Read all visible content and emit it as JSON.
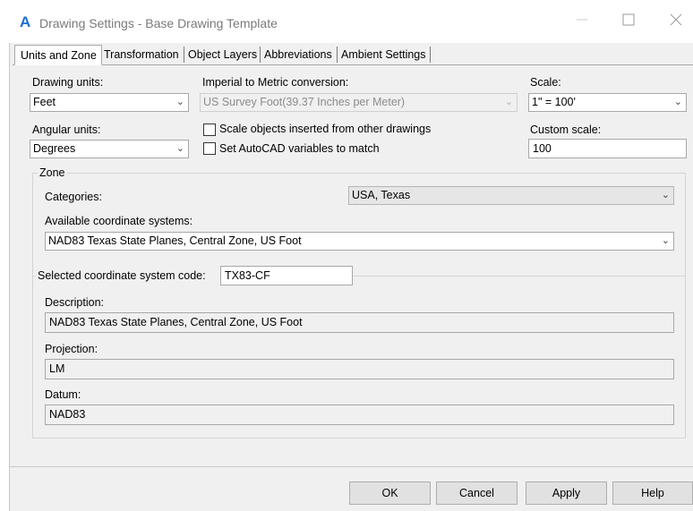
{
  "window": {
    "title": "Drawing Settings - Base Drawing Template"
  },
  "tabs": [
    {
      "label": "Units and Zone",
      "active": true
    },
    {
      "label": "Transformation"
    },
    {
      "label": "Object Layers"
    },
    {
      "label": "Abbreviations"
    },
    {
      "label": "Ambient Settings"
    }
  ],
  "units": {
    "drawing_units_label": "Drawing units:",
    "drawing_units_value": "Feet",
    "conversion_label": "Imperial to Metric conversion:",
    "conversion_value": "US Survey Foot(39.37 Inches per Meter)",
    "scale_label": "Scale:",
    "scale_value": "1\" = 100'",
    "angular_units_label": "Angular units:",
    "angular_units_value": "Degrees",
    "scale_objects_label": "Scale objects inserted from other drawings",
    "set_autocad_label": "Set AutoCAD variables to match",
    "custom_scale_label": "Custom scale:",
    "custom_scale_value": "100"
  },
  "zone": {
    "group_label": "Zone",
    "categories_label": "Categories:",
    "categories_value": "USA, Texas",
    "available_label": "Available coordinate systems:",
    "available_value": "NAD83 Texas State Planes, Central Zone, US Foot",
    "code_label": "Selected coordinate system code:",
    "code_value": "TX83-CF",
    "description_label": "Description:",
    "description_value": "NAD83 Texas State Planes, Central Zone, US Foot",
    "projection_label": "Projection:",
    "projection_value": "LM",
    "datum_label": "Datum:",
    "datum_value": "NAD83"
  },
  "buttons": {
    "ok": "OK",
    "cancel": "Cancel",
    "apply": "Apply",
    "help": "Help"
  },
  "icons": {
    "app": "autocad-icon",
    "minimize": "minimize-icon",
    "maximize": "maximize-icon",
    "close": "close-icon",
    "dropdown": "chevron-down-icon"
  },
  "colors": {
    "accent": "#1f6fd0",
    "dialog_bg": "#f0f0f0"
  }
}
